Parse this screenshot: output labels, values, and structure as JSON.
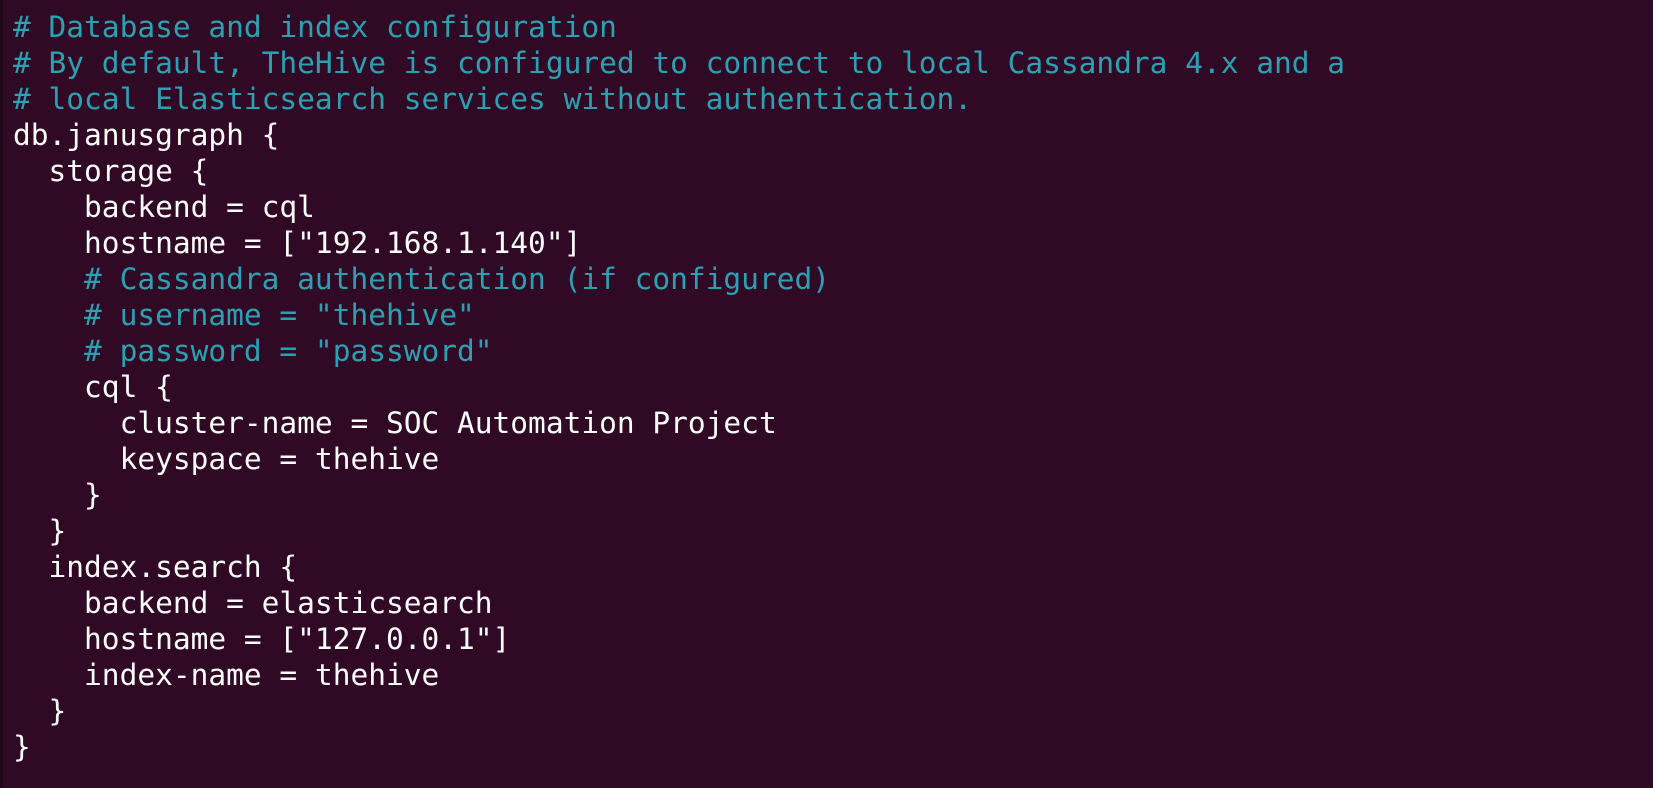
{
  "terminal": {
    "lines": [
      {
        "text": "# Database and index configuration",
        "type": "comment"
      },
      {
        "text": "# By default, TheHive is configured to connect to local Cassandra 4.x and a",
        "type": "comment"
      },
      {
        "text": "# local Elasticsearch services without authentication.",
        "type": "comment"
      },
      {
        "text": "db.janusgraph {",
        "type": "code"
      },
      {
        "text": "  storage {",
        "type": "code"
      },
      {
        "text": "    backend = cql",
        "type": "code"
      },
      {
        "text": "    hostname = [\"192.168.1.140\"]",
        "type": "code"
      },
      {
        "text": "    # Cassandra authentication (if configured)",
        "type": "comment"
      },
      {
        "text": "    # username = \"thehive\"",
        "type": "comment"
      },
      {
        "text": "    # password = \"password\"",
        "type": "comment"
      },
      {
        "text": "    cql {",
        "type": "code"
      },
      {
        "text": "      cluster-name = SOC Automation Project",
        "type": "code"
      },
      {
        "text": "      keyspace = thehive",
        "type": "code"
      },
      {
        "text": "    }",
        "type": "code"
      },
      {
        "text": "  }",
        "type": "code"
      },
      {
        "text": "  index.search {",
        "type": "code"
      },
      {
        "text": "    backend = elasticsearch",
        "type": "code"
      },
      {
        "text": "    hostname = [\"127.0.0.1\"]",
        "type": "code"
      },
      {
        "text": "    index-name = thehive",
        "type": "code"
      },
      {
        "text": "  }",
        "type": "code"
      },
      {
        "text": "}",
        "type": "code"
      }
    ]
  },
  "colors": {
    "background": "#300a24",
    "comment": "#2aa1b3",
    "code": "#ffffff"
  }
}
